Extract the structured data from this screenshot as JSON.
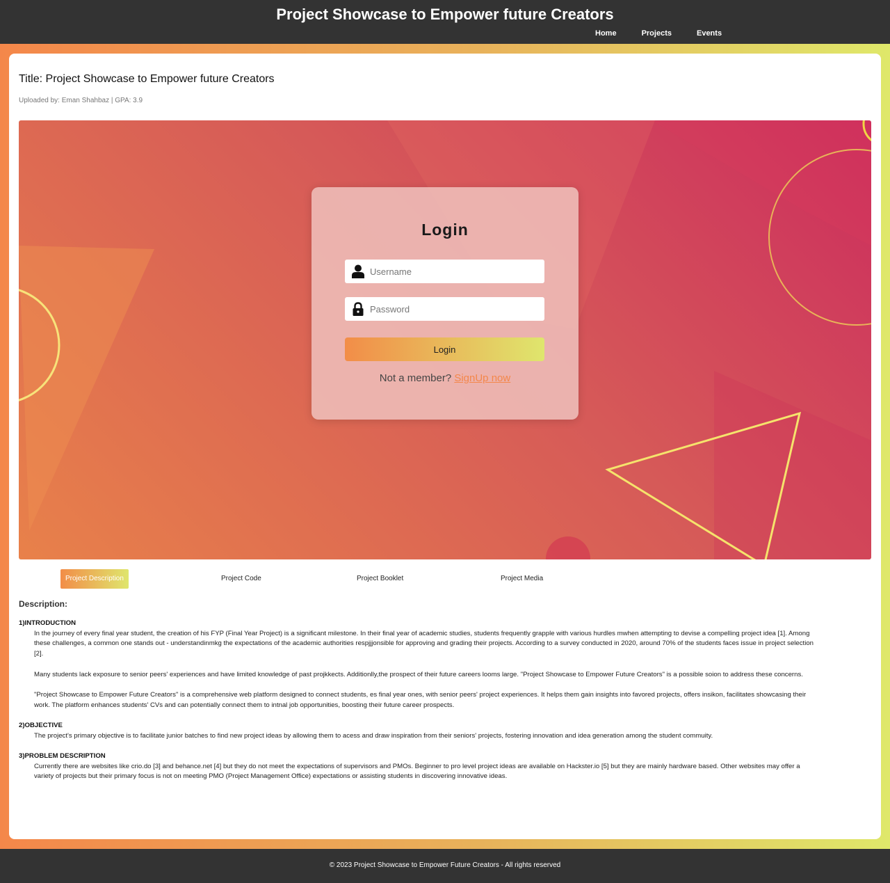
{
  "header": {
    "site_title": "Project Showcase to Empower future Creators",
    "nav": [
      "Home",
      "Projects",
      "Events"
    ]
  },
  "project": {
    "title": "Title: Project Showcase to Empower future Creators",
    "uploaded_by": "Uploaded by: Eman Shahbaz | GPA: 3.9"
  },
  "login": {
    "heading": "Login",
    "username_placeholder": "Username",
    "password_placeholder": "Password",
    "button": "Login",
    "member_text": "Not a member?",
    "signup_link": "SignUp now"
  },
  "tabs": [
    "Project Description",
    "Project Code",
    "Project Booklet",
    "Project Media"
  ],
  "active_tab": "Project Description",
  "description": {
    "label": "Description:",
    "sections": [
      {
        "heading": "1)INTRODUCTION",
        "paragraphs": [
          "In the journey of every final year student, the creation of his FYP (Final Year Project) is a significant milestone.  In their final year of academic studies, students frequently grapple with various hurdles mwhen attempting to devise a compelling project idea [1]. Among these challenges, a common one stands out - understandinmkg the expectations of the academic authorities respjjjonsible for approving and grading their projects. According to a survey conducted in 2020, around 70% of the students faces issue in project selection [2].",
          "Many students lack exposure to senior peers' experiences and have limited knowledge of past projkkects. Additionlly,the prospect of their future careers looms large.  \"Project Showcase to Empower Future Creators\" is a possible soion to address these concerns.",
          "\"Project Showcase to Empower Future Creators\" is a comprehensive web platform designed to connect students, es final year ones, with senior peers' project experiences. It helps them gain insights into favored projects, offers insikon, facilitates showcasing their work. The platform enhances students' CVs and can potentially connect them to intnal job opportunities, boosting their future career prospects."
        ]
      },
      {
        "heading": "2)OBJECTIVE",
        "paragraphs": [
          "The project's primary objective is to facilitate junior batches to find new project ideas by allowing them to acess and draw inspiration from their seniors' projects, fostering innovation and idea generation among the student commuity."
        ]
      },
      {
        "heading": "3)PROBLEM DESCRIPTION",
        "paragraphs": [
          "Currently there are websites like crio.do [3] and behance.net [4] but they do not meet the expectations of supervisors and PMOs. Beginner to pro level project ideas are available on Hackster.io [5] but they are mainly hardware based. Other websites may offer a variety of projects but their primary focus is not on meeting PMO (Project Management Office) expectations or assisting students in discovering innovative ideas."
        ]
      }
    ]
  },
  "footer": {
    "text": "© 2023 Project Showcase to Empower Future Creators - All rights reserved"
  },
  "colors": {
    "dark_bar": "#333333",
    "gradient_start": "#f4874a",
    "gradient_end": "#dfe86a",
    "hero_pink": "#cc2d5e",
    "hero_orange": "#e8814a",
    "link": "#f4874a"
  },
  "icons": [
    "user-icon",
    "lock-icon"
  ]
}
